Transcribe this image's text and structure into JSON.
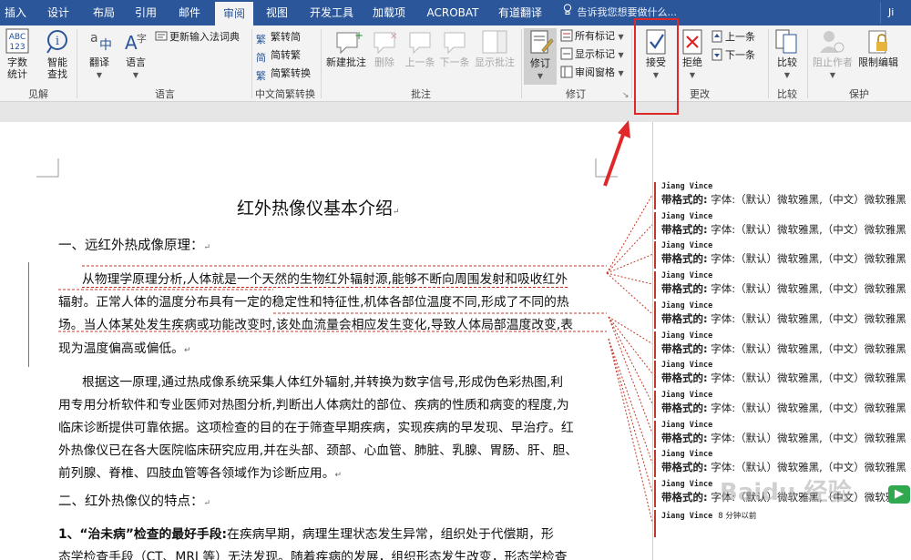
{
  "tabs": [
    {
      "label": "插入",
      "active": false
    },
    {
      "label": "设计",
      "active": false
    },
    {
      "label": "布局",
      "active": false
    },
    {
      "label": "引用",
      "active": false
    },
    {
      "label": "邮件",
      "active": false
    },
    {
      "label": "审阅",
      "active": true
    },
    {
      "label": "视图",
      "active": false
    },
    {
      "label": "开发工具",
      "active": false
    },
    {
      "label": "加载项",
      "active": false
    },
    {
      "label": "ACROBAT",
      "active": false
    },
    {
      "label": "有道翻译",
      "active": false
    }
  ],
  "tell_me": "告诉我您想要做什么...",
  "user_initials": "Ji",
  "ribbon": {
    "proofing": {
      "word_count_icon": "ABC\n123",
      "word_count": "字数\n统计",
      "smart_lookup": "智能\n查找",
      "group_label": "见解"
    },
    "language": {
      "translate": "翻译",
      "language": "语言",
      "update_ime": "更新输入法词典",
      "group_label": "语言"
    },
    "chinese_conversion": {
      "to_simplified": "繁转简",
      "to_traditional": "简转繁",
      "convert": "简繁转换",
      "group_label": "中文简繁转换"
    },
    "comments": {
      "new_comment": "新建批注",
      "delete": "删除",
      "previous": "上一条",
      "next": "下一条",
      "show_comments": "显示批注",
      "group_label": "批注"
    },
    "tracking": {
      "track_changes": "修订",
      "markup_select": "所有标记",
      "show_markup": "显示标记",
      "reviewing_pane": "审阅窗格",
      "group_label": "修订"
    },
    "changes": {
      "accept": "接受",
      "reject": "拒绝",
      "previous": "上一条",
      "next": "下一条",
      "group_label": "更改"
    },
    "compare": {
      "compare": "比较",
      "group_label": "比较"
    },
    "protect": {
      "block_authors": "阻止作者",
      "restrict_editing": "限制编辑",
      "group_label": "保护"
    }
  },
  "document": {
    "title": "红外热像仪基本介绍",
    "heading1": "一、远红外热成像原理：",
    "para1": [
      "从物理学原理分析,人体就是一个天然的生物红外辐射源,能够不断向周围发射和吸收红外",
      "辐射。正常人体的温度分布具有一定的稳定性和特征性,机体各部位温度不同,形成了不同的热",
      "场。当人体某处发生疾病或功能改变时,该处血流量会相应发生变化,导致人体局部温度改变,表",
      "现为温度偏高或偏低。"
    ],
    "para2": [
      "根据这一原理,通过热成像系统采集人体红外辐射,并转换为数字信号,形成伪色彩热图,利",
      "用专用分析软件和专业医师对热图分析,判断出人体病灶的部位、疾病的性质和病变的程度,为",
      "临床诊断提供可靠依据。这项检查的目的在于筛查早期疾病，实现疾病的早发现、早治疗。红",
      "外热像仪已在各大医院临床研究应用,并在头部、颈部、心血管、肺脏、乳腺、胃肠、肝、胆、",
      "前列腺、脊椎、四肢血管等各领域作为诊断应用。"
    ],
    "heading2": "二、红外热像仪的特点：",
    "para3_bold": "1、“治未病”检查的最好手段:",
    "para3": [
      "在疾病早期，病理生理状态发生异常，组织处于代偿期，形",
      "态学检查手段（CT、MRI 等）无法发现。随着疾病的发展，组织形态发生改变，形态学检查"
    ],
    "para_mark": "↵"
  },
  "markup": {
    "author": "Jiang Vince",
    "label": "带格式的:",
    "detail": "字体:（默认）微软雅黑,（中文）微软雅黑",
    "last_time": "8 分钟以前",
    "balloon_count": 12
  },
  "watermark": "Baidu 经验",
  "colors": {
    "tab_bar": "#2b579a",
    "highlight": "#e0282a",
    "revision": "#c0392b"
  }
}
